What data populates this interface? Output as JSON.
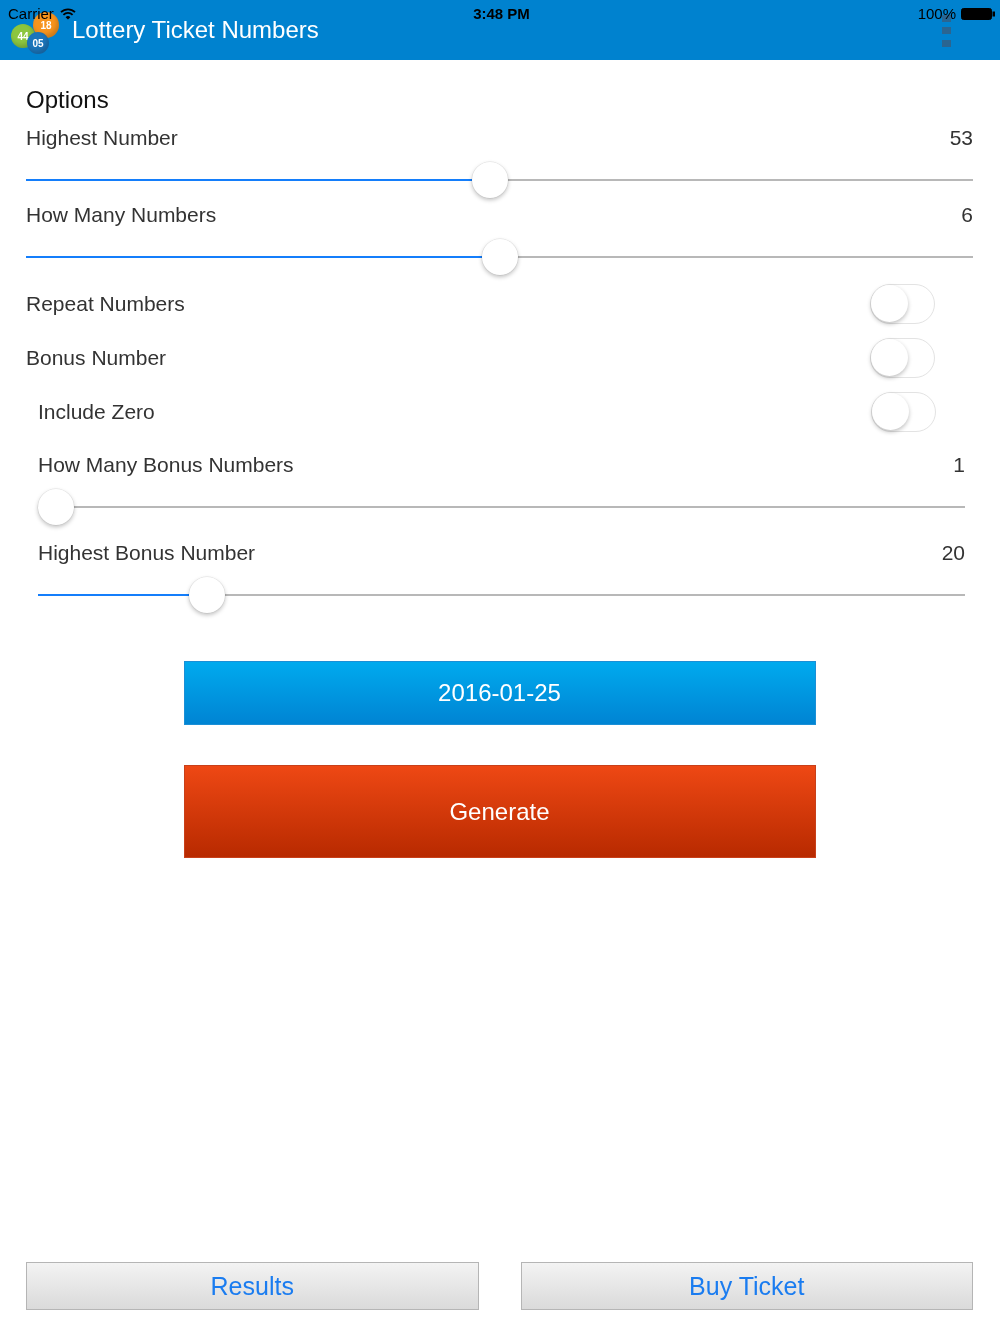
{
  "status_bar": {
    "carrier": "Carrier",
    "time": "3:48 PM",
    "battery": "100%"
  },
  "app_bar": {
    "logo_balls": [
      {
        "number": "44",
        "color": "#8cc63f"
      },
      {
        "number": "18",
        "color": "#f7941d"
      },
      {
        "number": "05",
        "color": "#1b75bb"
      }
    ],
    "title": "Lottery Ticket Numbers"
  },
  "options": {
    "heading": "Options",
    "rows": [
      {
        "kind": "slider",
        "label": "Highest Number",
        "value": "53",
        "level": 0.49
      },
      {
        "kind": "slider",
        "label": "How Many Numbers",
        "value": "6",
        "level": 0.5
      },
      {
        "kind": "toggle",
        "label": "Repeat Numbers",
        "on": false
      },
      {
        "kind": "toggle",
        "label": "Bonus Number",
        "on": false,
        "children": [
          {
            "kind": "toggle",
            "label": "Include Zero",
            "on": false
          },
          {
            "kind": "slider",
            "label": "How Many Bonus Numbers",
            "value": "1",
            "level": 0
          },
          {
            "kind": "slider",
            "label": "Highest Bonus Number",
            "value": "20",
            "level": 0.17
          }
        ]
      }
    ]
  },
  "actions": [
    {
      "kind": "date",
      "label": "2016-01-25"
    },
    {
      "kind": "generate",
      "label": "Generate"
    }
  ],
  "bottom_bar": [
    {
      "label": "Results"
    },
    {
      "label": "Buy Ticket"
    }
  ]
}
